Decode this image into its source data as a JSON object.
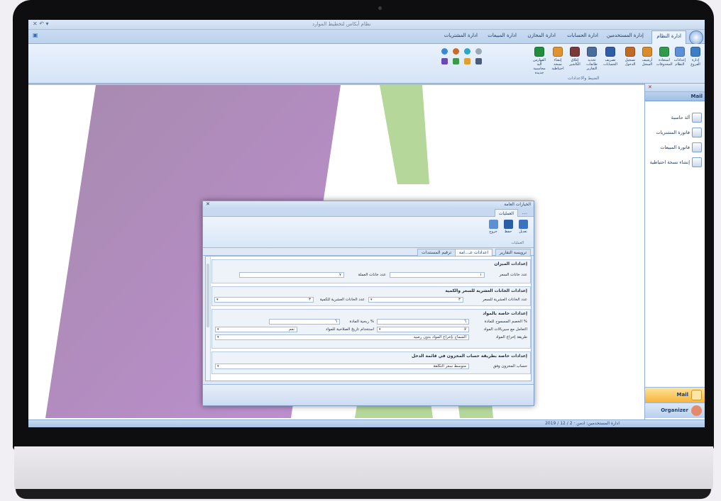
{
  "window": {
    "title": "نظام أبكاس لتخطيط الموارد",
    "quick_access": "✕ ↶ ▾"
  },
  "ribbon_tabs": [
    {
      "label": "ادارة النظام",
      "active": true
    },
    {
      "label": "إدارة المستخدمين"
    },
    {
      "label": "ادارة الحسابات"
    },
    {
      "label": "ادارة المخازن"
    },
    {
      "label": "ادارة المبيعات"
    },
    {
      "label": "ادارة المشتريات"
    }
  ],
  "ribbon_buttons": [
    {
      "label": "إدارة الفروع",
      "icon": "branches-icon",
      "color": "#3c7fc4"
    },
    {
      "label": "إعدادات النظام",
      "icon": "settings-icon",
      "color": "#5b8fd6"
    },
    {
      "label": "استعادة المحذوفات",
      "icon": "restore-icon",
      "color": "#2f9c4b"
    },
    {
      "label": "أرشيف السجل",
      "icon": "archive-icon",
      "color": "#d98c2b"
    },
    {
      "label": "تسجيل الدخول",
      "icon": "login-icon",
      "color": "#c06a24"
    },
    {
      "label": "تصريف الحسابات",
      "icon": "accounts-icon",
      "color": "#2f5ea8"
    },
    {
      "label": "تحديد طابعات التقارير",
      "icon": "printer-icon",
      "color": "#4a6d9c"
    },
    {
      "label": "إغلاق الكاشير",
      "icon": "cashier-icon",
      "color": "#7a3a3a"
    },
    {
      "label": "إنشاء نسخة احتياطية",
      "icon": "backup-icon",
      "color": "#e0932e"
    },
    {
      "label": "الفهارس الية محاسبية جديدة",
      "icon": "index-icon",
      "color": "#1f8f3c"
    }
  ],
  "ribbon_group_label": "الضبط والاعدادات",
  "status_text": "ادارة المستخدمين: ادمن · 2 / 12 / 2019",
  "navigation": {
    "toolbar_close": "✕",
    "header": "Mail",
    "items": [
      {
        "label": "آلة حاسبة",
        "icon": "calculator-icon"
      },
      {
        "label": "فاتورة المشتريات",
        "icon": "purchase-invoice-icon"
      },
      {
        "label": "فاتورة المبيعات",
        "icon": "sales-invoice-icon"
      },
      {
        "label": "إنشاء نسخة احتياطية",
        "icon": "backup-icon"
      }
    ],
    "mail_label": "Mail",
    "organizer_label": "Organizer"
  },
  "dialog": {
    "title": "الخيارات العامة",
    "close": "✕",
    "tabs": [
      {
        "label": "العمليات",
        "active": true
      },
      {
        "label": "...."
      }
    ],
    "buttons": [
      {
        "label": "تعديل",
        "icon": "edit-icon",
        "color": "#3a73c2"
      },
      {
        "label": "حفظ",
        "icon": "save-icon",
        "color": "#2b5ca6"
      },
      {
        "label": "خروج",
        "icon": "exit-icon",
        "color": "#5d8fd3"
      }
    ],
    "group_label": "العمليات",
    "inner_tabs": [
      {
        "label": "ترويسة التقارير"
      },
      {
        "label": "اعدادات عـ...امة",
        "active": true
      },
      {
        "label": "ترقيم المستندات"
      }
    ],
    "sections": [
      {
        "title": "إعدادات الميزان",
        "rows": [
          {
            "label": "عدد خانات السعر",
            "value": "١",
            "label2": "عدد خانات العملة",
            "value2": "٧"
          }
        ]
      },
      {
        "title": "إعدادات الخانات العشرية للسعر والكمية",
        "rows": [
          {
            "label": "عدد الخانات العشرية للسعر",
            "value": "٣",
            "label2": "عدد الخانات العشرية للكمية",
            "value2": "٣"
          }
        ]
      },
      {
        "title": "إعدادات خاصة بالمواد",
        "rows": [
          {
            "label": "الخصم المسموح للمادة %",
            "value": "٦",
            "label2": "ربحية المادة %",
            "value2": "٦"
          },
          {
            "label": "التعامل مع سيريالات المواد",
            "value": "لا",
            "label2": "استخدام تاريخ الصلاحية للمواد",
            "value2": "نعم"
          },
          {
            "label": "طريقة إخراج المواد",
            "value": "السماح بإخراج المواد بدون رصيد"
          }
        ]
      },
      {
        "title": "إعدادات خاصة بطريقة حساب المخزون في قائمة الدخل",
        "rows": [
          {
            "label": "حساب المخزون وفق",
            "value": "متوسط سعر التكلفة"
          }
        ]
      }
    ]
  },
  "colors": {
    "ribbon_accent": "#bcd3ee",
    "purple_shape": "#b07fbd",
    "green_shape": "#b5d89a"
  }
}
